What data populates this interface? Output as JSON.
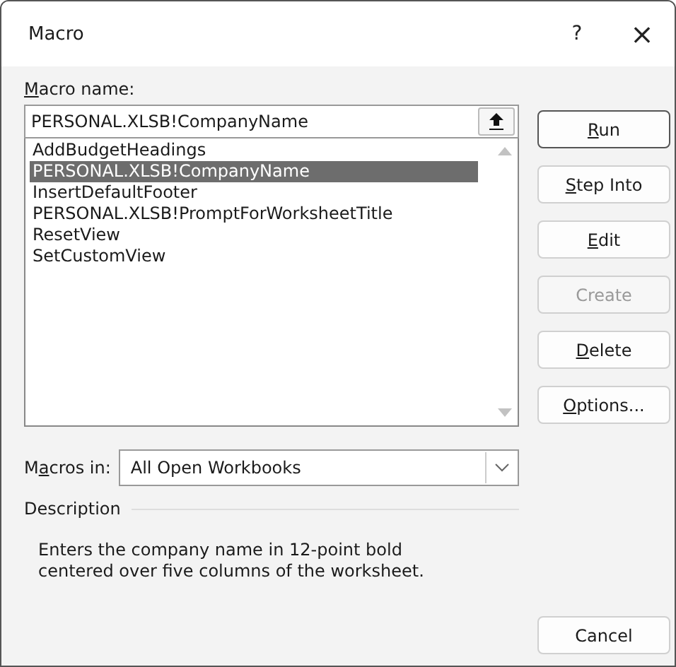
{
  "window": {
    "title": "Macro",
    "help": "?",
    "close": "×"
  },
  "macro_name": {
    "label": {
      "key": "M",
      "post": "acro name:"
    },
    "value": "PERSONAL.XLSB!CompanyName"
  },
  "macros": [
    {
      "name": "AddBudgetHeadings",
      "selected": false
    },
    {
      "name": "PERSONAL.XLSB!CompanyName",
      "selected": true
    },
    {
      "name": "InsertDefaultFooter",
      "selected": false
    },
    {
      "name": "PERSONAL.XLSB!PromptForWorksheetTitle",
      "selected": false
    },
    {
      "name": "ResetView",
      "selected": false
    },
    {
      "name": "SetCustomView",
      "selected": false
    }
  ],
  "buttons": [
    {
      "key": "R",
      "post": "un",
      "disabled": false,
      "default": true
    },
    {
      "key": "S",
      "post": "tep Into",
      "disabled": false,
      "default": false
    },
    {
      "key": "E",
      "post": "dit",
      "disabled": false,
      "default": false
    },
    {
      "pre": "Create",
      "disabled": true,
      "default": false
    },
    {
      "key": "D",
      "post": "elete",
      "disabled": false,
      "default": false
    },
    {
      "key": "O",
      "post": "ptions...",
      "disabled": false,
      "default": false
    }
  ],
  "macros_in": {
    "label": {
      "pre": "M",
      "key": "a",
      "post": "cros in:"
    },
    "value": "All Open Workbooks"
  },
  "description": {
    "heading": "Description",
    "text": "Enters the company name in 12-point bold centered over five columns of the worksheet."
  },
  "cancel": "Cancel"
}
